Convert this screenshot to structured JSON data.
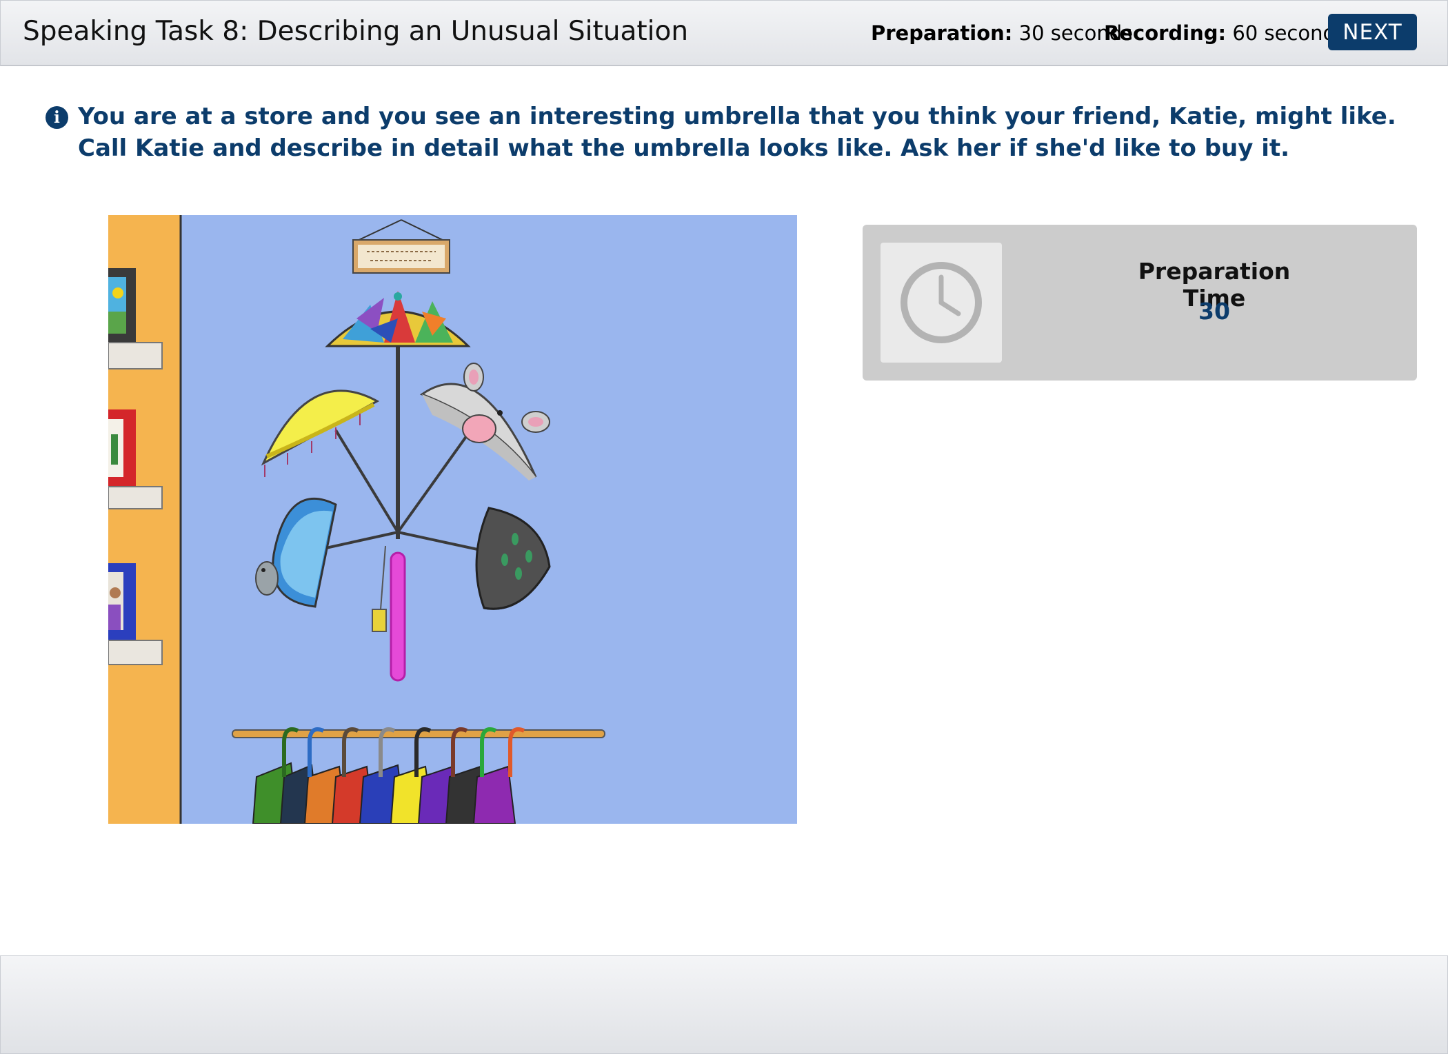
{
  "header": {
    "task_title": "Speaking Task 8: Describing an Unusual Situation",
    "preparation_label": "Preparation:",
    "preparation_value": "30 seconds",
    "recording_label": "Recording:",
    "recording_value": "60 seconds",
    "next_label": "NEXT"
  },
  "instruction": {
    "text": "You are at a store and you see an interesting umbrella that you think your friend, Katie, might like. Call Katie and describe in detail what the umbrella looks like. Ask her if she'd like to buy it."
  },
  "timer": {
    "label": "Preparation Time",
    "value": "30"
  },
  "colors": {
    "brand_navy": "#0c3c6b",
    "panel_gray": "#cccccc",
    "wall_blue": "#9ab6ee",
    "wall_orange": "#f5b44f"
  },
  "icons": {
    "info": "info-icon",
    "clock": "clock-icon"
  }
}
